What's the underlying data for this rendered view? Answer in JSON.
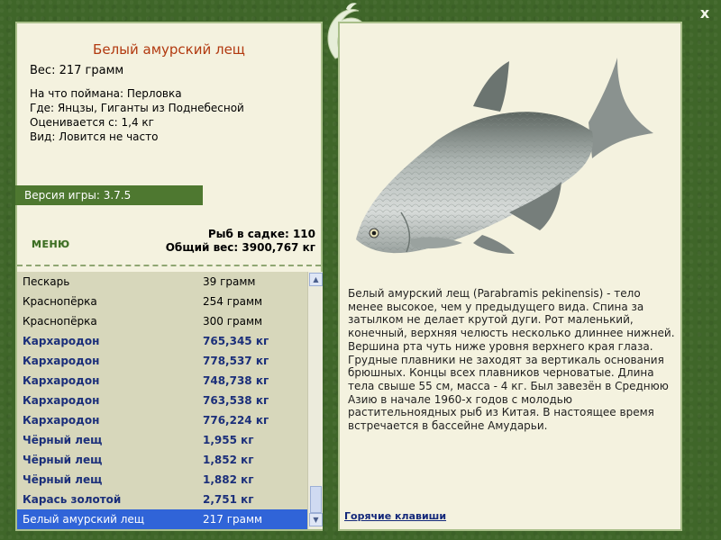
{
  "fish": {
    "title": "Белый амурский лещ",
    "weight": "Вес: 217 грамм",
    "bait": "На что поймана: Перловка",
    "location": "Где: Янцзы, Гиганты из Поднебесной",
    "price": "Оценивается с: 1,4 кг",
    "rarity": "Вид: Ловится не часто"
  },
  "version": "Версия игры: 3.7.5",
  "menu_label": "МЕНЮ",
  "stats": {
    "fish_count": "Рыб в садке: 110",
    "total_weight": "Общий вес: 3900,767 кг"
  },
  "catch_list": [
    {
      "name": "Пескарь",
      "weight": "39 грамм",
      "rare": false,
      "selected": false
    },
    {
      "name": "Краснопёрка",
      "weight": "254 грамм",
      "rare": false,
      "selected": false
    },
    {
      "name": "Краснопёрка",
      "weight": "300 грамм",
      "rare": false,
      "selected": false
    },
    {
      "name": "Кархародон",
      "weight": "765,345 кг",
      "rare": true,
      "selected": false
    },
    {
      "name": "Кархародон",
      "weight": "778,537 кг",
      "rare": true,
      "selected": false
    },
    {
      "name": "Кархародон",
      "weight": "748,738 кг",
      "rare": true,
      "selected": false
    },
    {
      "name": "Кархародон",
      "weight": "763,538 кг",
      "rare": true,
      "selected": false
    },
    {
      "name": "Кархародон",
      "weight": "776,224 кг",
      "rare": true,
      "selected": false
    },
    {
      "name": "Чёрный лещ",
      "weight": "1,955 кг",
      "rare": true,
      "selected": false
    },
    {
      "name": "Чёрный лещ",
      "weight": "1,852 кг",
      "rare": true,
      "selected": false
    },
    {
      "name": "Чёрный лещ",
      "weight": "1,882 кг",
      "rare": true,
      "selected": false
    },
    {
      "name": "Карась золотой",
      "weight": "2,751 кг",
      "rare": true,
      "selected": false
    },
    {
      "name": "Белый амурский лещ",
      "weight": "217 грамм",
      "rare": false,
      "selected": true
    }
  ],
  "description": "Белый амурский лещ (Parabramis pekinensis) - тело менее высокое, чем у предыдущего вида. Спина за затылком не делает крутой дуги. Рот маленький, конечный, верхняя челюсть несколько длиннее нижней. Вершина рта чуть ниже уровня верхнего края глаза. Грудные плавники не заходят за вертикаль основания брюшных. Концы всех плавников черноватые. Длина тела свыше 55 см, масса - 4 кг. Был завезён в Среднюю Азию в начале 1960-х годов с молодью растительноядных рыб из Китая. В настоящее время встречается в бассейне Амударьи.",
  "hotkeys_label": "Горячие клавиши",
  "close_label": "x",
  "colors": {
    "frame": "#3f6629",
    "panel": "#f4f2df",
    "title": "#b23a10",
    "rare_text": "#1b2f7a",
    "selected_row": "#3064d8"
  },
  "icons": {
    "close": "close-icon",
    "ornament": "dolphin-ornament-icon",
    "scroll_up": "scroll-up-arrow-icon",
    "scroll_down": "scroll-down-arrow-icon"
  }
}
